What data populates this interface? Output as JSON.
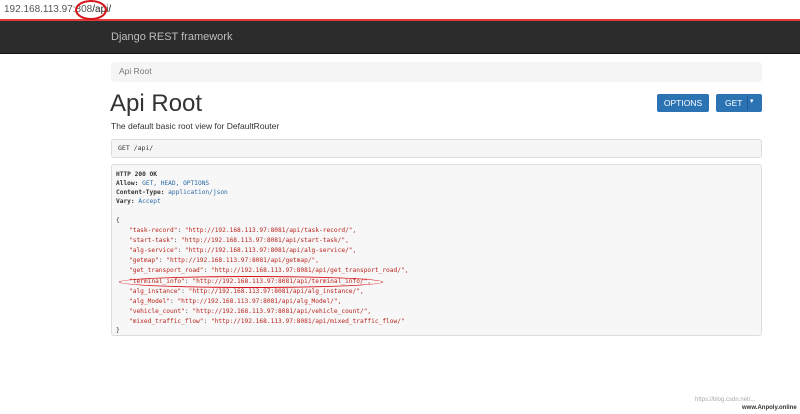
{
  "browser": {
    "url_host": "192.168.113.97:808",
    "url_path": "/api/"
  },
  "navbar": {
    "brand": "Django REST framework"
  },
  "breadcrumb": {
    "item": "Api Root"
  },
  "header": {
    "title": "Api Root",
    "description": "The default basic root view for DefaultRouter",
    "options_label": "OPTIONS",
    "get_label": "GET",
    "caret": "▾"
  },
  "request": {
    "line": "GET /api/"
  },
  "response": {
    "status": "HTTP 200 OK",
    "headers": [
      {
        "name": "Allow:",
        "value": "GET, HEAD, OPTIONS"
      },
      {
        "name": "Content-Type:",
        "value": "application/json"
      },
      {
        "name": "Vary:",
        "value": "Accept"
      }
    ],
    "open_brace": "{",
    "close_brace": "}",
    "entries": [
      {
        "key": "\"task-record\"",
        "value": "\"http://192.168.113.97:8081/api/task-record/\","
      },
      {
        "key": "\"start-task\"",
        "value": "\"http://192.168.113.97:8081/api/start-task/\","
      },
      {
        "key": "\"alg-service\"",
        "value": "\"http://192.168.113.97:8081/api/alg-service/\","
      },
      {
        "key": "\"getmap\"",
        "value": "\"http://192.168.113.97:8081/api/getmap/\","
      },
      {
        "key": "\"get_transport_road\"",
        "value": "\"http://192.168.113.97:8081/api/get_transport_road/\","
      },
      {
        "key": "\"terminal_info\"",
        "value": "\"http://192.168.113.97:8081/api/terminal_info/\","
      },
      {
        "key": "\"alg_instance\"",
        "value": "\"http://192.168.113.97:8081/api/alg_instance/\","
      },
      {
        "key": "\"alg_Model\"",
        "value": "\"http://192.168.113.97:8081/api/alg_Model/\","
      },
      {
        "key": "\"vehicle_count\"",
        "value": "\"http://192.168.113.97:8081/api/vehicle_count/\","
      },
      {
        "key": "\"mixed_traffic_flow\"",
        "value": "\"http://192.168.113.97:8081/api/mixed_traffic_flow/\""
      }
    ]
  },
  "watermark": {
    "line1": "https://blog.csdn.net/...",
    "line2": "www.Anpoly.online"
  }
}
